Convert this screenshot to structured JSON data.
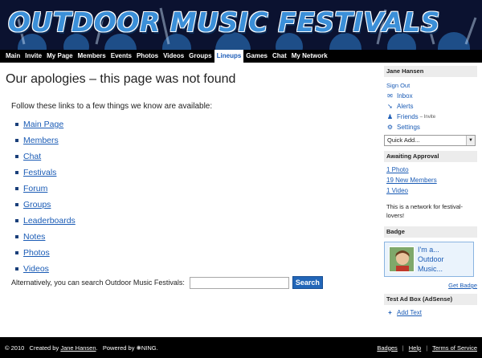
{
  "header": {
    "title": "OUTDOOR MUSIC FESTIVALS"
  },
  "nav": {
    "items": [
      "Main",
      "Invite",
      "My Page",
      "Members",
      "Events",
      "Photos",
      "Videos",
      "Groups",
      "Lineups",
      "Games",
      "Chat",
      "My Network"
    ],
    "active": "Lineups"
  },
  "main": {
    "title": "Our apologies – this page was not found",
    "intro": "Follow these links to a few things we know are available:",
    "links": [
      "Main Page",
      "Members",
      "Chat",
      "Festivals",
      "Forum",
      "Groups",
      "Leaderboards",
      "Notes",
      "Photos",
      "Videos"
    ],
    "search_label": "Alternatively, you can search Outdoor Music Festivals:",
    "search_value": "",
    "search_button": "Search"
  },
  "sidebar": {
    "user_name": "Jane Hansen",
    "sign_out": "Sign Out",
    "inbox": "Inbox",
    "alerts": "Alerts",
    "friends": "Friends",
    "friends_invite": "– Invite",
    "settings": "Settings",
    "quick_add": "Quick Add...",
    "awaiting_title": "Awaiting Approval",
    "awaiting_photo": "1 Photo",
    "awaiting_members": "19 New Members",
    "awaiting_video": "1 Video",
    "network_text": "This is a network for festival-lovers!",
    "badge_title": "Badge",
    "badge_line1": "I'm a...",
    "badge_line2": "Outdoor",
    "badge_line3": "Music...",
    "get_badge": "Get Badge",
    "ad_title": "Test Ad Box (AdSense)",
    "add_text": "Add Text"
  },
  "footer": {
    "copyright": "© 2010   Created by",
    "creator": "Jane Hansen",
    "powered_by": ".   Powered by",
    "ning": "NING.",
    "badges": "Badges",
    "help": "Help",
    "terms": "Terms of Service"
  },
  "colors": {
    "link": "#1a5bb5",
    "nav_bg": "#000000",
    "header_bg": "#0a0f1e",
    "title_blue": "#3b8fd8",
    "search_button": "#2266b8"
  }
}
